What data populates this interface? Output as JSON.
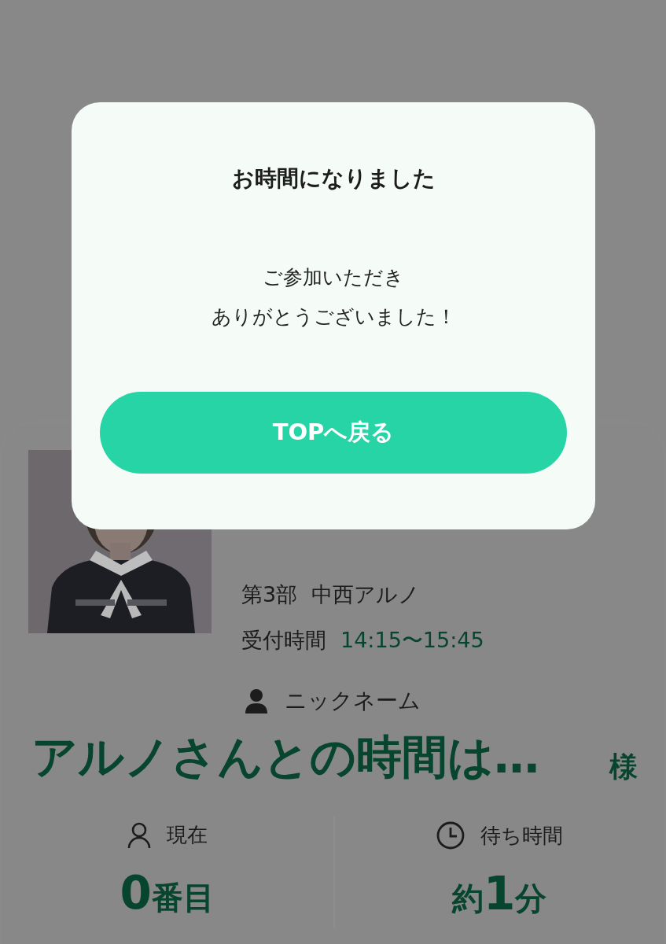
{
  "card": {
    "session": "第3部",
    "performer": "中西アルノ",
    "reception_label": "受付時間",
    "reception_time": "14:15〜15:45",
    "nickname_label": "ニックネーム",
    "nickname": "アルノさんとの時間は…",
    "honorific": "様",
    "stats": [
      {
        "kind": "position",
        "label": "現在",
        "number": "0",
        "suffix": "番目"
      },
      {
        "kind": "wait",
        "label": "待ち時間",
        "prefix": "約",
        "number": "1",
        "suffix": "分"
      }
    ]
  },
  "dialog": {
    "title": "お時間になりました",
    "message_lines": [
      "ご参加いただき",
      "ありがとうございました！"
    ],
    "button": "TOPへ戻る"
  }
}
